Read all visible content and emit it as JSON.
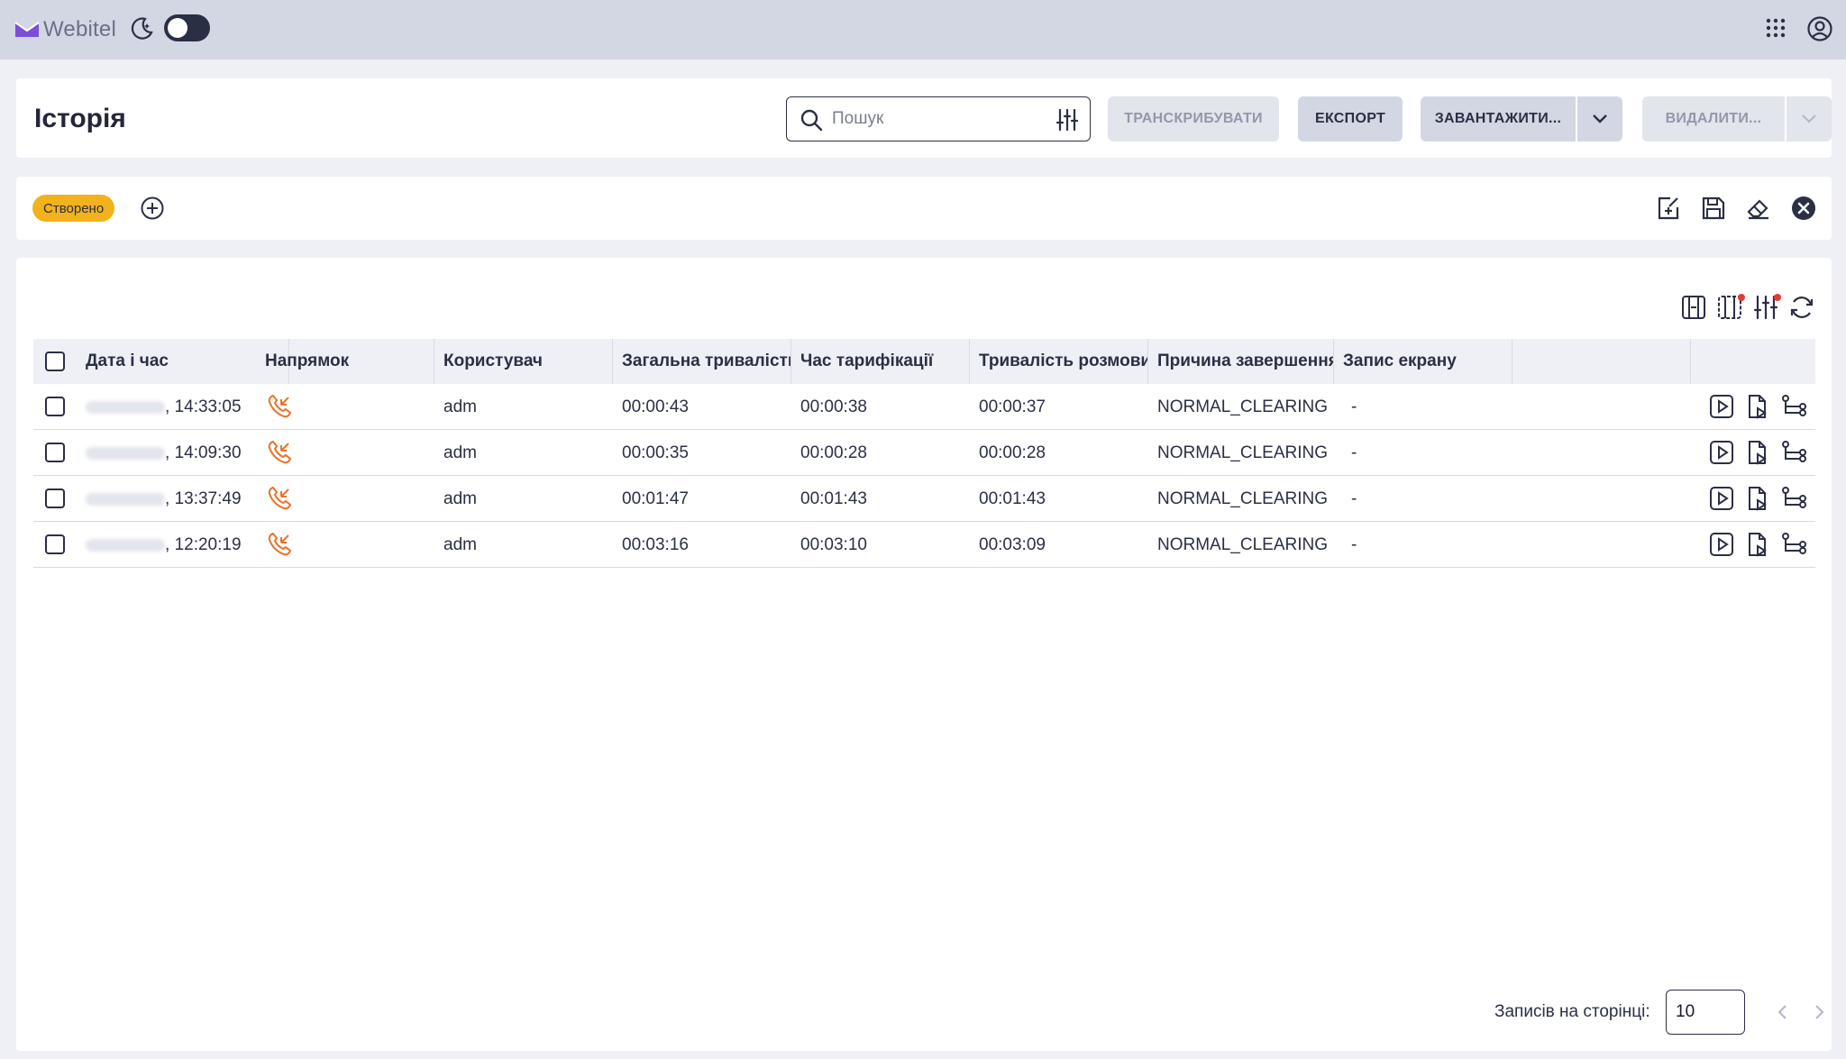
{
  "app": {
    "name": "Webitel"
  },
  "header": {
    "title": "Історія",
    "search": {
      "placeholder": "Пошук",
      "value": ""
    },
    "buttons": {
      "transcribe": "ТРАНСКРИБУВАТИ",
      "export": "ЕКСПОРТ",
      "download": "ЗАВАНТАЖИТИ...",
      "delete": "ВИДАЛИТИ..."
    }
  },
  "filters": {
    "chips": [
      "Створено"
    ]
  },
  "table": {
    "columns": [
      "Дата і час",
      "Напрямок",
      "Користувач",
      "Загальна тривалість",
      "Час тарифікації",
      "Тривалість розмови",
      "Причина завершення",
      "Запис екрану"
    ],
    "rows": [
      {
        "datetime": "14:33:05",
        "direction": "incoming",
        "user": "adm",
        "total": "00:00:43",
        "billing": "00:00:38",
        "talk": "00:00:37",
        "hangup": "NORMAL_CLEARING",
        "screen": "-"
      },
      {
        "datetime": "14:09:30",
        "direction": "incoming",
        "user": "adm",
        "total": "00:00:35",
        "billing": "00:00:28",
        "talk": "00:00:28",
        "hangup": "NORMAL_CLEARING",
        "screen": "-"
      },
      {
        "datetime": "13:37:49",
        "direction": "incoming",
        "user": "adm",
        "total": "00:01:47",
        "billing": "00:01:43",
        "talk": "00:01:43",
        "hangup": "NORMAL_CLEARING",
        "screen": "-"
      },
      {
        "datetime": "12:20:19",
        "direction": "incoming",
        "user": "adm",
        "total": "00:03:16",
        "billing": "00:03:10",
        "talk": "00:03:09",
        "hangup": "NORMAL_CLEARING",
        "screen": "-"
      }
    ]
  },
  "pagination": {
    "label": "Записів на сторінці:",
    "page_size": "10"
  },
  "colors": {
    "accent": "#f2b21b",
    "direction_icon": "#e8732a",
    "dark": "#2b2f45",
    "topbar": "#d3d7e3"
  }
}
